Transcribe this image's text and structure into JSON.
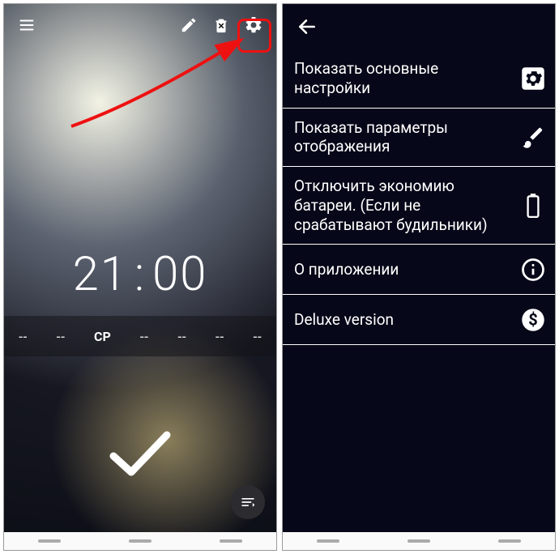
{
  "left": {
    "time_hours": "21",
    "time_mins": "00",
    "days": [
      "--",
      "--",
      "СР",
      "--",
      "--",
      "--",
      "--"
    ]
  },
  "right": {
    "items": [
      {
        "label": "Показать основные настройки",
        "icon": "gear"
      },
      {
        "label": "Показать параметры отображения",
        "icon": "brush"
      },
      {
        "label": "Отключить экономию батареи. (Если не срабатывают будильники)",
        "icon": "battery"
      },
      {
        "label": "О приложении",
        "icon": "info"
      },
      {
        "label": "Deluxe version",
        "icon": "dollar"
      }
    ]
  }
}
